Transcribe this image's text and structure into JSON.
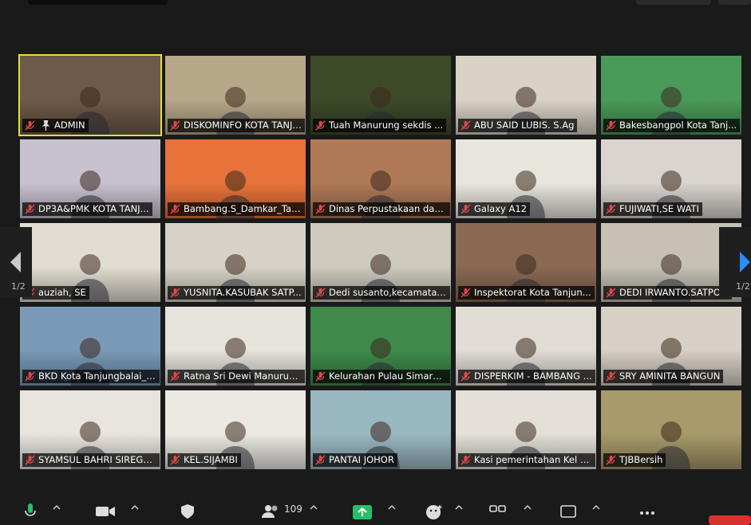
{
  "participants": [
    {
      "name": "ADMIN",
      "pinned": true,
      "bg": "#6e5a48"
    },
    {
      "name": "DISKOMINFO KOTA TANJU...",
      "bg": "#b8a88a"
    },
    {
      "name": "Tuah Manurung sekdis ...",
      "bg": "#3c4a28"
    },
    {
      "name": "ABU SAID LUBIS. S.Ag",
      "bg": "#d9d2c6"
    },
    {
      "name": "Bakesbangpol Kota Tanj...",
      "bg": "#4a9a5a"
    },
    {
      "name": "DP3A&PMK KOTA TANJ...",
      "bg": "#c8c2cf"
    },
    {
      "name": "Bambang.S_Damkar_Tan...",
      "bg": "#e8733a"
    },
    {
      "name": "Dinas Perpustakaan dan...",
      "bg": "#b07a58"
    },
    {
      "name": "Galaxy A12",
      "bg": "#e8e6dc"
    },
    {
      "name": "FUJIWATI,SE WATI",
      "bg": "#d9d4cf"
    },
    {
      "name": "auziah, SE",
      "bg": "#e2ddd2"
    },
    {
      "name": "YUSNITA.KASUBAK SATP...",
      "bg": "#d8d3c8"
    },
    {
      "name": "Dedi susanto,kecamatan...",
      "bg": "#cfcabe"
    },
    {
      "name": "Inspektorat Kota Tanjun...",
      "bg": "#8a6a54"
    },
    {
      "name": "DEDI IRWANTO.SATPO...",
      "bg": "#c6c0b5"
    },
    {
      "name": "BKD Kota Tanjungbalai_I...",
      "bg": "#7a9ab8"
    },
    {
      "name": "Ratna Sri Dewi Manurun...",
      "bg": "#e6e3dc"
    },
    {
      "name": "Kelurahan Pulau Simard...",
      "bg": "#3f8a4a"
    },
    {
      "name": "DISPERKIM - BAMBANG ...",
      "bg": "#e1ddd5"
    },
    {
      "name": "SRY AMINITA BANGUN",
      "bg": "#d7d0c6"
    },
    {
      "name": "SYAMSUL BAHRI SIREGA...",
      "bg": "#e8e4de"
    },
    {
      "name": "KEL.SIJAMBI",
      "bg": "#ece9e3"
    },
    {
      "name": "PANTAI JOHOR",
      "bg": "#9ab8c2"
    },
    {
      "name": "Kasi pemerintahan Kel B...",
      "bg": "#e4e0d8"
    },
    {
      "name": "TJBBersih",
      "bg": "#a89a6a"
    }
  ],
  "pagination": {
    "left": "1/2",
    "right": "1/2"
  },
  "toolbar": {
    "participant_count": "109"
  }
}
